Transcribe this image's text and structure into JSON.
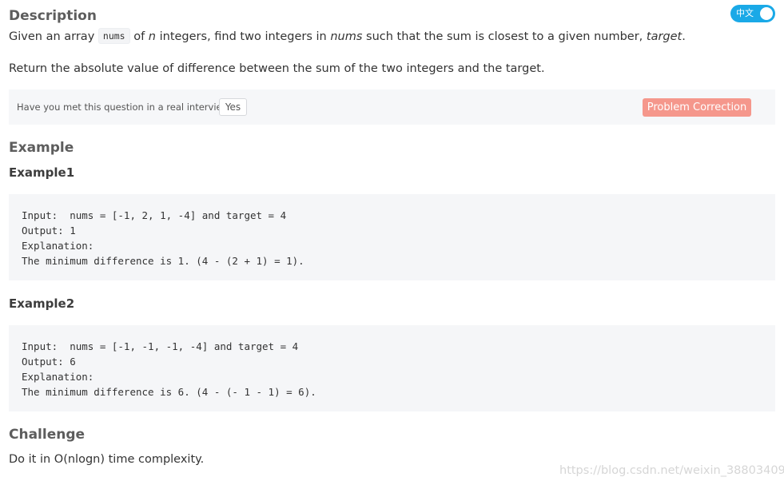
{
  "toggle": {
    "label": "中文",
    "on": true
  },
  "description": {
    "heading": "Description",
    "p1_before_code": "Given an array ",
    "p1_code": "nums",
    "p1_after_code": " of ",
    "p1_n": "n",
    "p1_mid": " integers, find two integers in ",
    "p1_nums": "nums",
    "p1_mid2": " such that the sum is closest to a given number, ",
    "p1_target": "target",
    "p1_end": ".",
    "p2": "Return the absolute value of difference between the sum of the two integers and the target."
  },
  "interview": {
    "question": "Have you met this question in a real interview?",
    "yes_label": "Yes",
    "correction_label": "Problem Correction"
  },
  "example": {
    "heading": "Example",
    "ex1": {
      "title": "Example1",
      "lines": [
        "Input:  nums = [-1, 2, 1, -4] and target = 4",
        "Output: 1",
        "Explanation:",
        "The minimum difference is 1. (4 - (2 + 1) = 1)."
      ]
    },
    "ex2": {
      "title": "Example2",
      "lines": [
        "Input:  nums = [-1, -1, -1, -4] and target = 4",
        "Output: 6",
        "Explanation:",
        "The minimum difference is 6. (4 - (- 1 - 1) = 6)."
      ]
    }
  },
  "challenge": {
    "heading": "Challenge",
    "text": "Do it in O(nlogn) time complexity."
  },
  "watermark": "https://blog.csdn.net/weixin_38803409",
  "colors": {
    "toggle_bg": "#1aa9e7",
    "correction_bg": "#f5978c",
    "panel_bg": "#f5f6f8"
  }
}
